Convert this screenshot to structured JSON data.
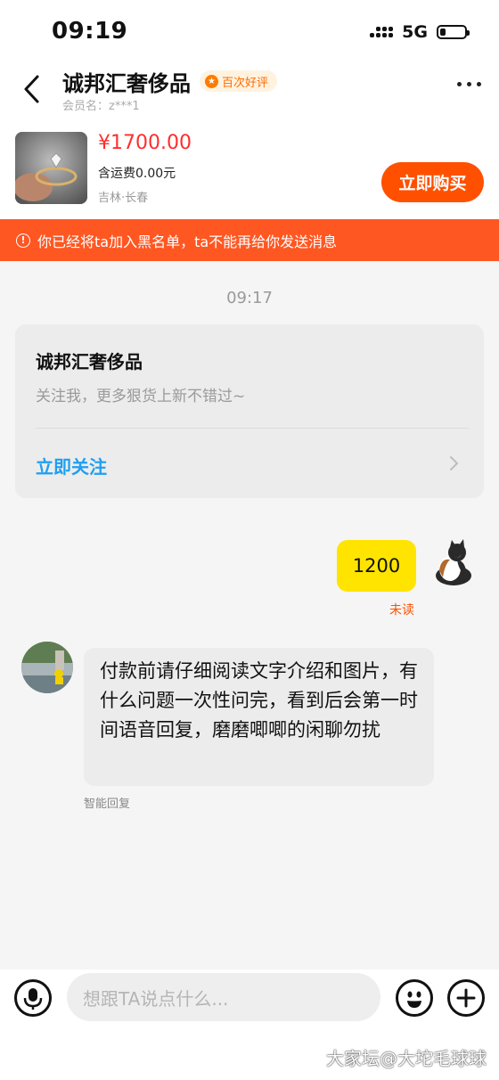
{
  "status_bar": {
    "time": "09:19",
    "network": "5G"
  },
  "header": {
    "shop_name": "诚邦汇奢侈品",
    "badge": "百次好评",
    "member_label": "会员名：",
    "member_name": "z***1"
  },
  "product": {
    "price": "¥1700.00",
    "shipping": "含运费0.00元",
    "location": "吉林·长春",
    "buy_label": "立即购买"
  },
  "banner": {
    "text": "你已经将ta加入黑名单，ta不能再给你发送消息"
  },
  "chat": {
    "timestamp": "09:17",
    "card": {
      "title": "诚邦汇奢侈品",
      "desc": "关注我，更多狠货上新不错过~",
      "action": "立即关注"
    },
    "my_message": {
      "text": "1200",
      "status": "未读"
    },
    "other_message": {
      "text": "付款前请仔细阅读文字介绍和图片，有什么问题一次性问完，看到后会第一时间语音回复，磨磨唧唧的闲聊勿扰",
      "tag": "智能回复"
    }
  },
  "input_bar": {
    "placeholder": "想跟TA说点什么..."
  },
  "watermark": "大家坛@大坨毛球球",
  "colors": {
    "accent_orange": "#ff5000",
    "banner_red": "#ff5722",
    "price_red": "#ff2e2e",
    "follow_blue": "#1e9ff0",
    "my_bubble_yellow": "#ffe400"
  },
  "icons": [
    "back-icon",
    "medal-icon",
    "more-icon",
    "warning-icon",
    "chevron-right-icon",
    "mic-icon",
    "emoji-icon",
    "plus-icon"
  ]
}
